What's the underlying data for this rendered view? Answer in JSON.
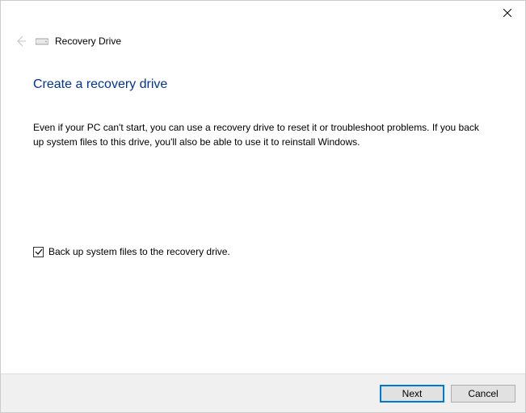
{
  "titlebar": {},
  "header": {
    "window_title": "Recovery Drive"
  },
  "content": {
    "heading": "Create a recovery drive",
    "description": "Even if your PC can't start, you can use a recovery drive to reset it or troubleshoot problems. If you back up system files to this drive, you'll also be able to use it to reinstall Windows.",
    "checkbox_label": "Back up system files to the recovery drive."
  },
  "footer": {
    "next_label": "Next",
    "cancel_label": "Cancel"
  }
}
